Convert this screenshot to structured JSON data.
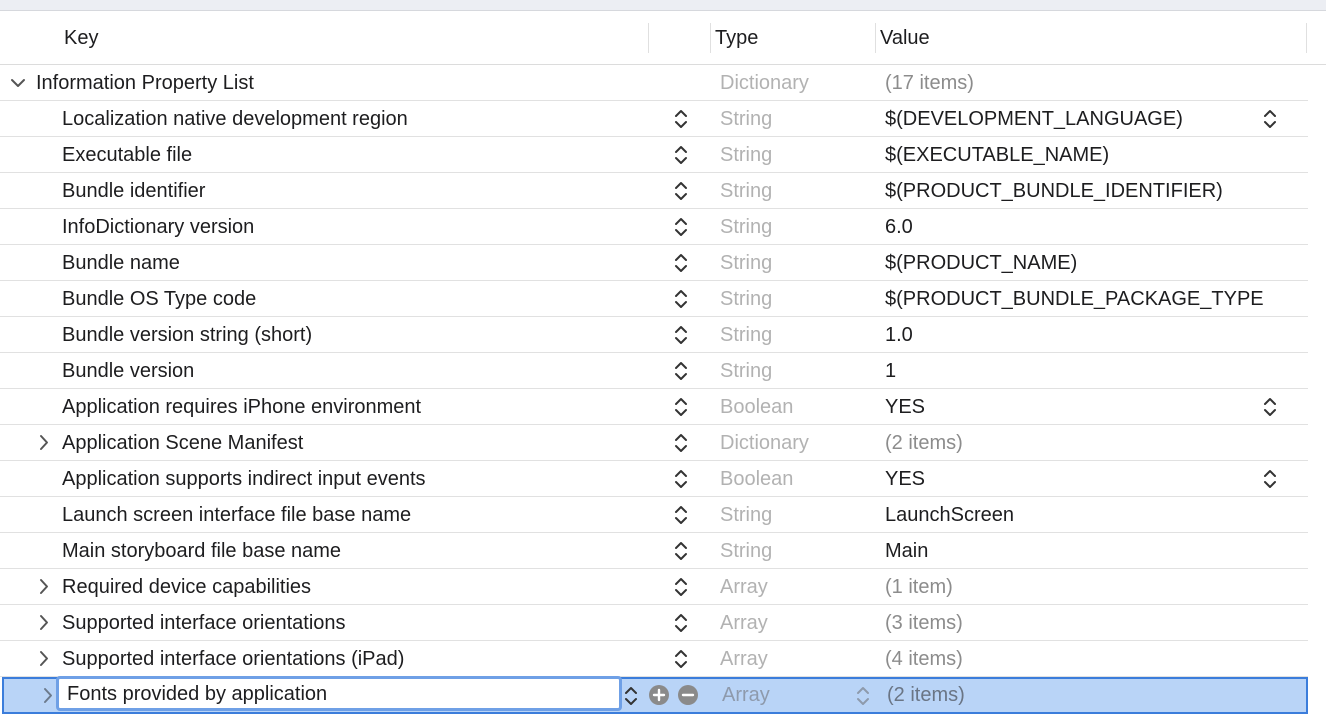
{
  "header": {
    "key": "Key",
    "type": "Type",
    "value": "Value"
  },
  "root": {
    "key": "Information Property List",
    "type": "Dictionary",
    "value": "(17 items)"
  },
  "rows": [
    {
      "key": "Localization native development region",
      "type": "String",
      "value": "$(DEVELOPMENT_LANGUAGE)",
      "disclosure": false,
      "value_stepper": true,
      "muted": false
    },
    {
      "key": "Executable file",
      "type": "String",
      "value": "$(EXECUTABLE_NAME)",
      "disclosure": false,
      "value_stepper": false,
      "muted": false
    },
    {
      "key": "Bundle identifier",
      "type": "String",
      "value": "$(PRODUCT_BUNDLE_IDENTIFIER)",
      "disclosure": false,
      "value_stepper": false,
      "muted": false
    },
    {
      "key": "InfoDictionary version",
      "type": "String",
      "value": "6.0",
      "disclosure": false,
      "value_stepper": false,
      "muted": false
    },
    {
      "key": "Bundle name",
      "type": "String",
      "value": "$(PRODUCT_NAME)",
      "disclosure": false,
      "value_stepper": false,
      "muted": false
    },
    {
      "key": "Bundle OS Type code",
      "type": "String",
      "value": "$(PRODUCT_BUNDLE_PACKAGE_TYPE",
      "disclosure": false,
      "value_stepper": false,
      "muted": false
    },
    {
      "key": "Bundle version string (short)",
      "type": "String",
      "value": "1.0",
      "disclosure": false,
      "value_stepper": false,
      "muted": false
    },
    {
      "key": "Bundle version",
      "type": "String",
      "value": "1",
      "disclosure": false,
      "value_stepper": false,
      "muted": false
    },
    {
      "key": "Application requires iPhone environment",
      "type": "Boolean",
      "value": "YES",
      "disclosure": false,
      "value_stepper": true,
      "muted": false
    },
    {
      "key": "Application Scene Manifest",
      "type": "Dictionary",
      "value": "(2 items)",
      "disclosure": true,
      "value_stepper": false,
      "muted": true
    },
    {
      "key": "Application supports indirect input events",
      "type": "Boolean",
      "value": "YES",
      "disclosure": false,
      "value_stepper": true,
      "muted": false
    },
    {
      "key": "Launch screen interface file base name",
      "type": "String",
      "value": "LaunchScreen",
      "disclosure": false,
      "value_stepper": false,
      "muted": false
    },
    {
      "key": "Main storyboard file base name",
      "type": "String",
      "value": "Main",
      "disclosure": false,
      "value_stepper": false,
      "muted": false
    },
    {
      "key": "Required device capabilities",
      "type": "Array",
      "value": "(1 item)",
      "disclosure": true,
      "value_stepper": false,
      "muted": true
    },
    {
      "key": "Supported interface orientations",
      "type": "Array",
      "value": "(3 items)",
      "disclosure": true,
      "value_stepper": false,
      "muted": true
    },
    {
      "key": "Supported interface orientations (iPad)",
      "type": "Array",
      "value": "(4 items)",
      "disclosure": true,
      "value_stepper": false,
      "muted": true
    }
  ],
  "selected_row": {
    "key": "Fonts provided by application",
    "type": "Array",
    "value": "(2 items)"
  },
  "icons": {
    "stepper": "up-down-chevron-icon",
    "disclosure_collapsed": "chevron-right-icon",
    "disclosure_expanded": "chevron-down-icon",
    "add": "plus-circle-icon",
    "remove": "minus-circle-icon"
  },
  "colors": {
    "selection": "#b9d4f7",
    "selection_border": "#3b7ddb",
    "type_text": "#b2b2b2"
  }
}
